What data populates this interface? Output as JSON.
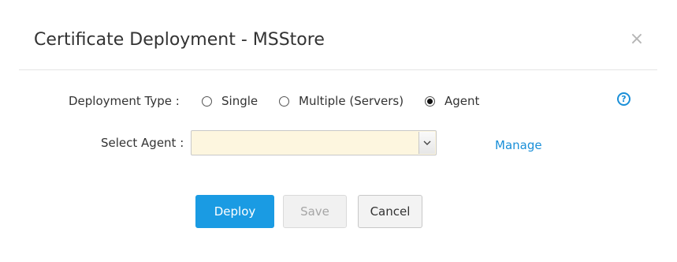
{
  "dialog": {
    "title": "Certificate Deployment - MSStore",
    "close_label": "×"
  },
  "form": {
    "deployment_type_label": "Deployment Type :",
    "deployment_options": [
      {
        "label": "Single",
        "checked": false
      },
      {
        "label": "Multiple (Servers)",
        "checked": false
      },
      {
        "label": "Agent",
        "checked": true
      }
    ],
    "select_agent_label": "Select Agent :",
    "select_agent_value": "",
    "manage_link": "Manage",
    "help_glyph": "?"
  },
  "buttons": {
    "deploy": "Deploy",
    "save": "Save",
    "cancel": "Cancel"
  },
  "icons": {
    "help": "help-circle-icon",
    "close": "close-icon",
    "dropdown": "chevron-down-icon"
  },
  "colors": {
    "accent": "#1a9be3",
    "link": "#1a8fd8",
    "select_bg": "#fdf6df"
  }
}
